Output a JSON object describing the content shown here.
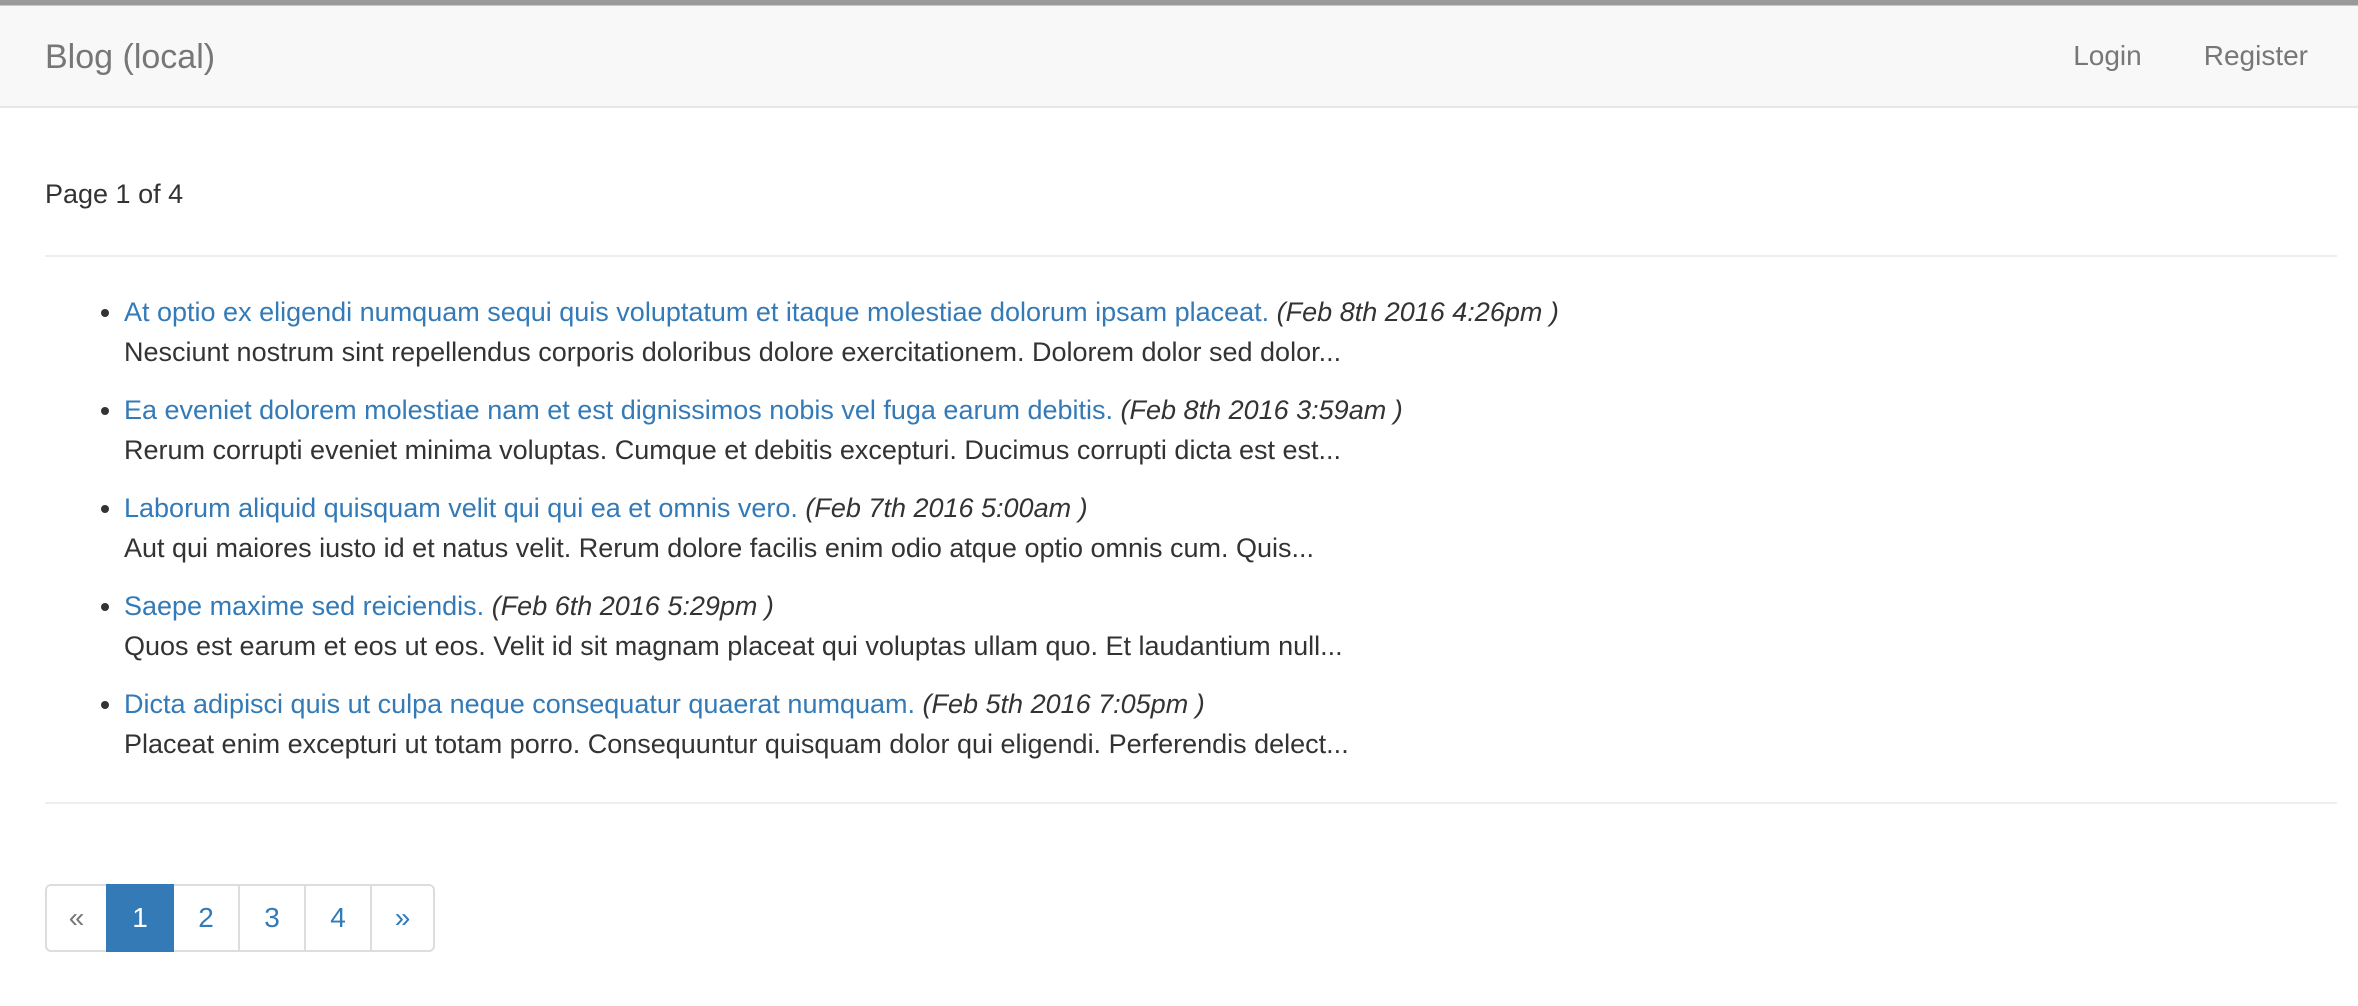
{
  "navbar": {
    "brand": "Blog (local)",
    "links": {
      "login": "Login",
      "register": "Register"
    }
  },
  "page_info": "Page 1 of 4",
  "posts": [
    {
      "title": "At optio ex eligendi numquam sequi quis voluptatum et itaque molestiae dolorum ipsam placeat.",
      "date": "(Feb 8th 2016 4:26pm )",
      "excerpt": "Nesciunt nostrum sint repellendus corporis doloribus dolore exercitationem. Dolorem dolor sed dolor..."
    },
    {
      "title": "Ea eveniet dolorem molestiae nam et est dignissimos nobis vel fuga earum debitis.",
      "date": "(Feb 8th 2016 3:59am )",
      "excerpt": "Rerum corrupti eveniet minima voluptas. Cumque et debitis excepturi. Ducimus corrupti dicta est est..."
    },
    {
      "title": "Laborum aliquid quisquam velit qui qui ea et omnis vero.",
      "date": "(Feb 7th 2016 5:00am )",
      "excerpt": "Aut qui maiores iusto id et natus velit. Rerum dolore facilis enim odio atque optio omnis cum. Quis..."
    },
    {
      "title": "Saepe maxime sed reiciendis.",
      "date": "(Feb 6th 2016 5:29pm )",
      "excerpt": "Quos est earum et eos ut eos. Velit id sit magnam placeat qui voluptas ullam quo. Et laudantium null..."
    },
    {
      "title": "Dicta adipisci quis ut culpa neque consequatur quaerat numquam.",
      "date": "(Feb 5th 2016 7:05pm )",
      "excerpt": "Placeat enim excepturi ut totam porro. Consequuntur quisquam dolor qui eligendi. Perferendis delect..."
    }
  ],
  "pagination": {
    "prev": "«",
    "pages": [
      "1",
      "2",
      "3",
      "4"
    ],
    "next": "»",
    "current": "1"
  },
  "colors": {
    "link": "#337ab7",
    "navbar_bg": "#f8f8f8",
    "text": "#333333",
    "muted": "#777777"
  }
}
